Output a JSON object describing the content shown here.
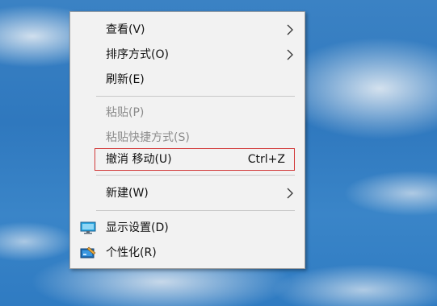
{
  "context_menu": {
    "items": [
      {
        "label": "查看(V)",
        "submenu": true,
        "enabled": true
      },
      {
        "label": "排序方式(O)",
        "submenu": true,
        "enabled": true
      },
      {
        "label": "刷新(E)",
        "submenu": false,
        "enabled": true
      },
      {
        "label": "粘贴(P)",
        "submenu": false,
        "enabled": false
      },
      {
        "label": "粘贴快捷方式(S)",
        "submenu": false,
        "enabled": false
      },
      {
        "label": "撤消 移动(U)",
        "shortcut": "Ctrl+Z",
        "submenu": false,
        "enabled": true,
        "highlighted": true
      },
      {
        "label": "新建(W)",
        "submenu": true,
        "enabled": true
      },
      {
        "label": "显示设置(D)",
        "icon": "display-settings-icon",
        "submenu": false,
        "enabled": true
      },
      {
        "label": "个性化(R)",
        "icon": "personalize-icon",
        "submenu": false,
        "enabled": true
      }
    ]
  },
  "colors": {
    "menu_background": "#f2f2f2",
    "highlight_border": "#d23b3b",
    "disabled_text": "#8c8c8c",
    "desktop_blue": "#3a85c8"
  }
}
